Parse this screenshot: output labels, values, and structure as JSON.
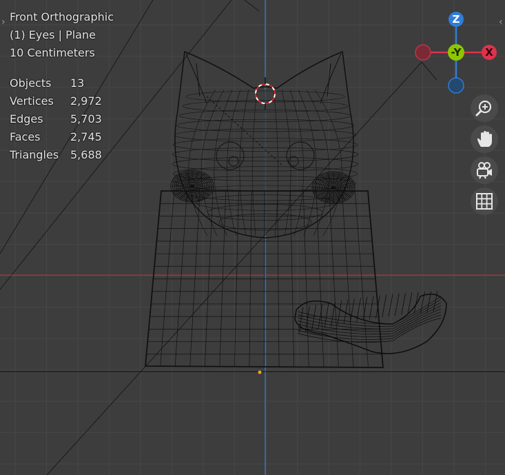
{
  "viewport": {
    "view_name": "Front Orthographic",
    "active_object": "(1) Eyes | Plane",
    "scale": "10 Centimeters"
  },
  "stats": [
    {
      "label": "Objects",
      "value": "13"
    },
    {
      "label": "Vertices",
      "value": "2,972"
    },
    {
      "label": "Edges",
      "value": "5,703"
    },
    {
      "label": "Faces",
      "value": "2,745"
    },
    {
      "label": "Triangles",
      "value": "5,688"
    }
  ],
  "gizmo": {
    "z_label": "Z",
    "y_label": "-Y",
    "x_label": "X",
    "colors": {
      "x": "#e0314b",
      "y": "#8cc700",
      "z": "#2f7ed8"
    }
  },
  "nav_buttons": [
    {
      "name": "zoom",
      "icon": "zoom-in-icon"
    },
    {
      "name": "pan",
      "icon": "hand-icon"
    },
    {
      "name": "camera",
      "icon": "camera-icon"
    },
    {
      "name": "ortho-grid",
      "icon": "grid-icon"
    }
  ],
  "colors": {
    "background": "#3d3d3d",
    "grid_minor": "#434343",
    "axis_x": "#b03a42",
    "axis_z": "#3a72b8",
    "wire": "#0f0f0f"
  }
}
